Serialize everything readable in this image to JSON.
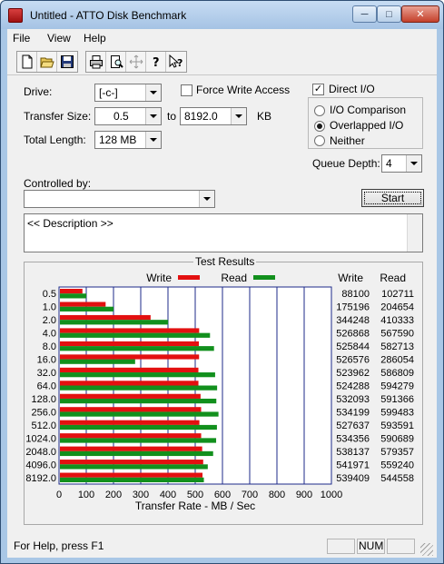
{
  "window": {
    "title": "Untitled - ATTO Disk Benchmark"
  },
  "menu": [
    "File",
    "View",
    "Help"
  ],
  "toolbar": {
    "icons": [
      "new-document-icon",
      "open-folder-icon",
      "save-icon",
      "print-icon",
      "print-preview-icon",
      "move-icon",
      "help-icon",
      "context-help-icon"
    ]
  },
  "form": {
    "drive_label": "Drive:",
    "drive_value": "[-c-]",
    "force_write_label": "Force Write Access",
    "force_write_checked": false,
    "transfer_size_label": "Transfer Size:",
    "transfer_from": "0.5",
    "transfer_to_label": "to",
    "transfer_to": "8192.0",
    "transfer_unit": "KB",
    "total_length_label": "Total Length:",
    "total_length_value": "128 MB",
    "direct_io_label": "Direct I/O",
    "direct_io_checked": true,
    "io_comparison_label": "I/O Comparison",
    "overlapped_io_label": "Overlapped I/O",
    "neither_label": "Neither",
    "selected_mode": "overlapped",
    "queue_depth_label": "Queue Depth:",
    "queue_depth_value": "4",
    "controlled_by_label": "Controlled by:",
    "controlled_by_value": "",
    "start_label": "Start",
    "description": "<< Description >>"
  },
  "results": {
    "title": "Test Results",
    "write_col": "Write",
    "read_col": "Read"
  },
  "chart_data": {
    "type": "bar",
    "orientation": "horizontal",
    "xlabel": "Transfer Rate - MB / Sec",
    "xlim": [
      0,
      1000
    ],
    "xticks": [
      0,
      100,
      200,
      300,
      400,
      500,
      600,
      700,
      800,
      900,
      1000
    ],
    "grid": true,
    "legend": "top",
    "categories": [
      "0.5",
      "1.0",
      "2.0",
      "4.0",
      "8.0",
      "16.0",
      "32.0",
      "64.0",
      "128.0",
      "256.0",
      "512.0",
      "1024.0",
      "2048.0",
      "4096.0",
      "8192.0"
    ],
    "series": [
      {
        "name": "Write",
        "color": "#e31010",
        "values": [
          86.0,
          171.1,
          336.2,
          514.5,
          513.5,
          514.2,
          511.7,
          511.8,
          519.6,
          521.7,
          515.3,
          521.8,
          525.5,
          529.3,
          526.8
        ]
      },
      {
        "name": "Read",
        "color": "#12901d",
        "values": [
          100.3,
          199.9,
          400.7,
          554.3,
          569.0,
          279.4,
          573.1,
          580.4,
          577.5,
          585.4,
          579.7,
          576.8,
          565.8,
          546.1,
          531.8
        ]
      }
    ],
    "write_kb": [
      "88100",
      "175196",
      "344248",
      "526868",
      "525844",
      "526576",
      "523962",
      "524288",
      "532093",
      "534199",
      "527637",
      "534356",
      "538137",
      "541971",
      "539409"
    ],
    "read_kb": [
      "102711",
      "204654",
      "410333",
      "567590",
      "582713",
      "286054",
      "586809",
      "594279",
      "591366",
      "599483",
      "593591",
      "590689",
      "579357",
      "559240",
      "544558"
    ]
  },
  "status": {
    "help_text": "For Help, press F1",
    "num": "NUM"
  }
}
